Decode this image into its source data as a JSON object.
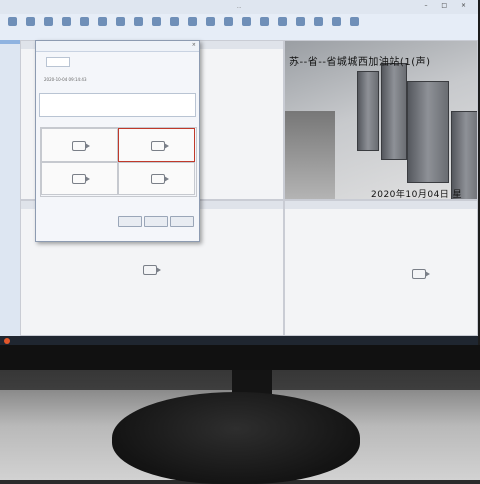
{
  "app": {
    "title": "...",
    "window_controls": "– □ ×"
  },
  "toolbar": {
    "items": [
      "",
      "",
      "",
      "",
      "",
      "",
      "",
      "",
      "",
      "",
      "",
      "",
      "",
      "",
      "",
      "",
      "",
      "",
      "",
      ""
    ]
  },
  "sidebar": {
    "items": [
      "",
      "",
      "",
      "",
      "",
      ""
    ]
  },
  "dialog": {
    "title": "",
    "row1_value": "",
    "row2_value": "2020-10-04 09:14:43",
    "section_grid_label": "",
    "buttons": [
      "",
      "",
      ""
    ],
    "footer_text": ""
  },
  "live_feed": {
    "overlay_location": "苏--省--省城城西加油站(1(声)",
    "overlay_timestamp": "2020年10月04日  星"
  },
  "colors": {
    "accent": "#8fb3e0",
    "selected_cell_border": "#c0392b",
    "start_button": "#e2572b"
  }
}
